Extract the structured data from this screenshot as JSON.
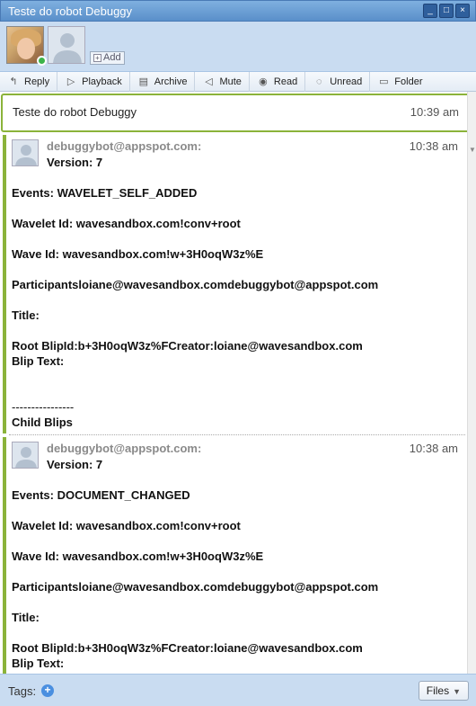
{
  "window": {
    "title": "Teste do robot Debuggy",
    "controls": [
      "_",
      "□",
      "×"
    ]
  },
  "participants": {
    "add_label": "Add"
  },
  "toolbar": [
    {
      "label": "Reply",
      "icon": "reply-icon",
      "glyph": "↰"
    },
    {
      "label": "Playback",
      "icon": "play-icon",
      "glyph": "▷"
    },
    {
      "label": "Archive",
      "icon": "archive-icon",
      "glyph": "▤"
    },
    {
      "label": "Mute",
      "icon": "mute-icon",
      "glyph": "◁"
    },
    {
      "label": "Read",
      "icon": "eye-icon",
      "glyph": "◉"
    },
    {
      "label": "Unread",
      "icon": "unread-icon",
      "glyph": "◌"
    },
    {
      "label": "Folder",
      "icon": "folder-icon",
      "glyph": "▭"
    }
  ],
  "root_blip": {
    "text": "Teste do robot Debuggy",
    "time": "10:39 am"
  },
  "blips": [
    {
      "author": "debuggybot@appspot.com:",
      "time": "10:38 am",
      "lines": [
        "Version: 7",
        "",
        "Events: WAVELET_SELF_ADDED",
        "",
        "Wavelet Id: wavesandbox.com!conv+root",
        "",
        "Wave Id: wavesandbox.com!w+3H0oqW3z%E",
        "",
        "Participantsloiane@wavesandbox.comdebuggybot@appspot.com",
        "",
        "Title:",
        "",
        "Root BlipId:b+3H0oqW3z%FCreator:loiane@wavesandbox.com",
        "Blip Text:",
        "",
        "",
        "----------------",
        "Child Blips"
      ]
    },
    {
      "author": "debuggybot@appspot.com:",
      "time": "10:38 am",
      "lines": [
        "Version: 7",
        "",
        "Events: DOCUMENT_CHANGED",
        "",
        "Wavelet Id: wavesandbox.com!conv+root",
        "",
        "Wave Id: wavesandbox.com!w+3H0oqW3z%E",
        "",
        "Participantsloiane@wavesandbox.comdebuggybot@appspot.com",
        "",
        "Title:",
        "",
        "Root BlipId:b+3H0oqW3z%FCreator:loiane@wavesandbox.com",
        "Blip Text:"
      ]
    }
  ],
  "footer": {
    "tags_label": "Tags:",
    "files_label": "Files"
  },
  "colors": {
    "accent": "#8bb33a",
    "header_bg": "#c9dcf1",
    "titlebar": "#5a8fca"
  }
}
